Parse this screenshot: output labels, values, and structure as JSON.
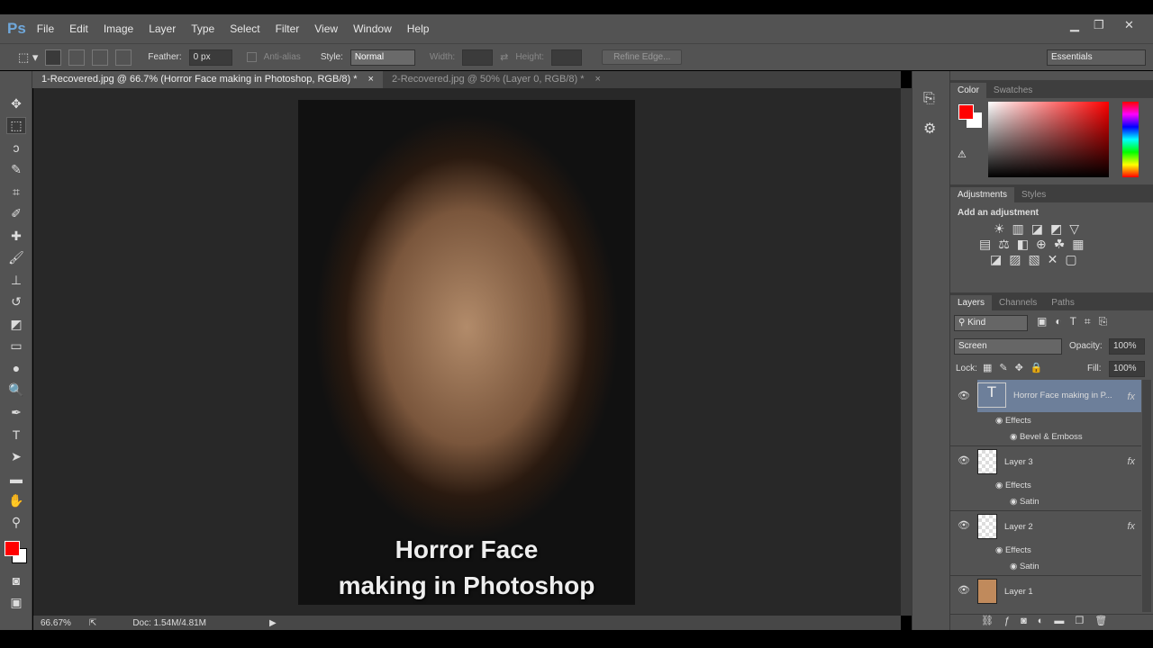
{
  "app": {
    "logo": "Ps",
    "menu": [
      "File",
      "Edit",
      "Image",
      "Layer",
      "Type",
      "Select",
      "Filter",
      "View",
      "Window",
      "Help"
    ],
    "window_controls": [
      "minimize",
      "restore",
      "close"
    ]
  },
  "options": {
    "feather_label": "Feather:",
    "feather_value": "0 px",
    "antialias_label": "Anti-alias",
    "style_label": "Style:",
    "style_value": "Normal",
    "width_label": "Width:",
    "height_label": "Height:",
    "refine_edge": "Refine Edge...",
    "workspace": "Essentials"
  },
  "tabs": [
    {
      "label": "1-Recovered.jpg @ 66.7% (Horror Face making in Photoshop, RGB/8) *",
      "active": true
    },
    {
      "label": "2-Recovered.jpg @ 50% (Layer 0, RGB/8) *",
      "active": false
    }
  ],
  "image": {
    "line1": "Horror Face",
    "line2": "making in Photoshop"
  },
  "status": {
    "zoom": "66.67%",
    "doc": "Doc: 1.54M/4.81M"
  },
  "color_panel": {
    "tabs": [
      "Color",
      "Swatches"
    ],
    "foreground": "#ff0000",
    "background": "#ffffff"
  },
  "adjustments": {
    "tabs": [
      "Adjustments",
      "Styles"
    ],
    "heading": "Add an adjustment"
  },
  "layers_panel": {
    "tabs": [
      "Layers",
      "Channels",
      "Paths"
    ],
    "filter": "Kind",
    "blend_mode": "Screen",
    "opacity_label": "Opacity:",
    "opacity": "100%",
    "lock_label": "Lock:",
    "fill_label": "Fill:",
    "fill": "100%",
    "layers": [
      {
        "name": "Horror Face making in P...",
        "effects_label": "Effects",
        "effect": "Bevel & Emboss"
      },
      {
        "name": "Layer 3",
        "effects_label": "Effects",
        "effect": "Satin"
      },
      {
        "name": "Layer 2",
        "effects_label": "Effects",
        "effect": "Satin"
      },
      {
        "name": "Layer 1"
      }
    ],
    "fx": "fx"
  }
}
